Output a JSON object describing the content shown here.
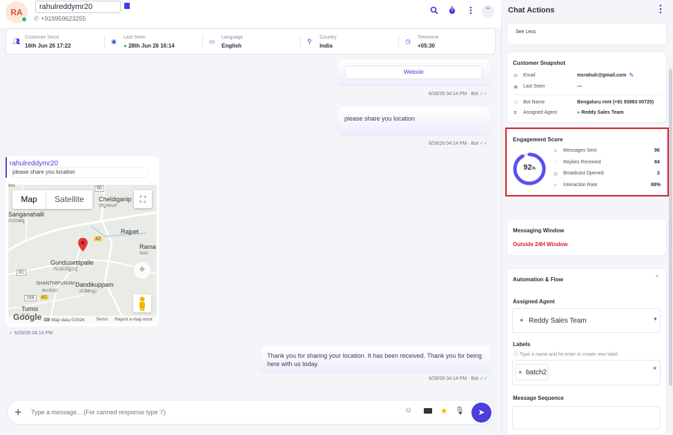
{
  "contact": {
    "initials": "RA",
    "name": "rahulreddymr20",
    "phone": "+919959623255"
  },
  "header_icons": [
    "search-icon",
    "timer-icon",
    "more-vertical-icon",
    "chevron-up-icon"
  ],
  "info_bar": [
    {
      "icon": "users-icon",
      "label": "Customer Since",
      "value": "16th Jun 26 17:22"
    },
    {
      "icon": "eye-icon",
      "label": "Last Seen",
      "value": "28th Jun 26 16:14"
    },
    {
      "icon": "language-icon",
      "label": "Language",
      "value": "English"
    },
    {
      "icon": "location-pin-icon",
      "label": "Country",
      "value": "India"
    },
    {
      "icon": "clock-icon",
      "label": "Timezone",
      "value": "+05:30"
    }
  ],
  "messages": {
    "website_button": "Website",
    "meta_1": "6/28/26 04:14 PM · Bot",
    "location_request": "please share you location",
    "meta_2": "6/28/26 04:14 PM · Bot",
    "reply_name": "rahulreddymr20",
    "reply_quote": "please share you location",
    "incoming_meta": "6/28/26 04:14 PM",
    "thanks": "Thank you for sharing your location. It has been received. Thank you for being here with us today.",
    "meta_3": "6/28/26 04:14 PM · Bot"
  },
  "map": {
    "tab_map": "Map",
    "tab_satellite": "Satellite",
    "places": [
      "Sanganahalli",
      "ಸಂಗನಹಳ್ಳಿ",
      "Cheldiganip",
      "ಚೆಲ್ದಿಗಾನಿಪ್",
      "Rajpet",
      "Rama",
      "ರಾಮ",
      "Gundusettipalle",
      "ಗುಂಡುಸೆಟ್ಟಿಪಲ್ಲೆ",
      "SHANTHIPURAM",
      "ಶಾಂತಿಪುರ",
      "Dandikuppam",
      "ದಂಡಿಕುಪ್ಪಂ",
      "Tumsi",
      "ತುಮ್ಸಿ"
    ],
    "roads": [
      "90",
      "42",
      "81",
      "168",
      "42"
    ],
    "attribution": "Map data ©2026",
    "terms": "Terms",
    "report": "Report a map error",
    "google": "Google",
    "topleft": "ಶಿರಾ"
  },
  "composer": {
    "placeholder": "Type a message... (For canned response type '/')"
  },
  "sidebar": {
    "title": "Chat Actions",
    "see_less": "See Less",
    "snapshot": {
      "title": "Customer Snapshot",
      "email_label": "Email",
      "email_value": "mcrahulr@gmail.com",
      "last_seen_label": "Last Seen",
      "last_seen_value": "---",
      "bot_label": "Bot Name",
      "bot_value": "Bengaluru rent (+91 93983 00725)",
      "agent_label": "Assigned Agent",
      "agent_value": "Reddy Sales Team"
    },
    "engagement": {
      "title": "Engagement Score",
      "score": "92",
      "score_unit": "%",
      "score_fraction": 0.92,
      "rows": [
        {
          "icon": "send-icon",
          "label": "Messages Sent",
          "value": "96"
        },
        {
          "icon": "chat-bubble-icon",
          "label": "Replies Received",
          "value": "84"
        },
        {
          "icon": "broadcast-icon",
          "label": "Broadcast Opened",
          "value": "2"
        },
        {
          "icon": "trend-icon",
          "label": "Interaction Rate",
          "value": "88%"
        }
      ]
    },
    "messaging_window": {
      "title": "Messaging Window",
      "status": "Outside 24H Window",
      "status_color": "#d71f26"
    },
    "automation": {
      "title": "Automation & Flow",
      "assigned_agent_label": "Assigned Agent",
      "assigned_agent_value": "Reddy Sales Team",
      "labels_title": "Labels",
      "labels_hint": "Type a name and hit enter to create new label",
      "label_chip": "batch2",
      "sequence_title": "Message Sequence"
    }
  },
  "colors": {
    "accent": "#4a3fd8",
    "highlight": "#d71f26",
    "online": "#2bb673"
  }
}
